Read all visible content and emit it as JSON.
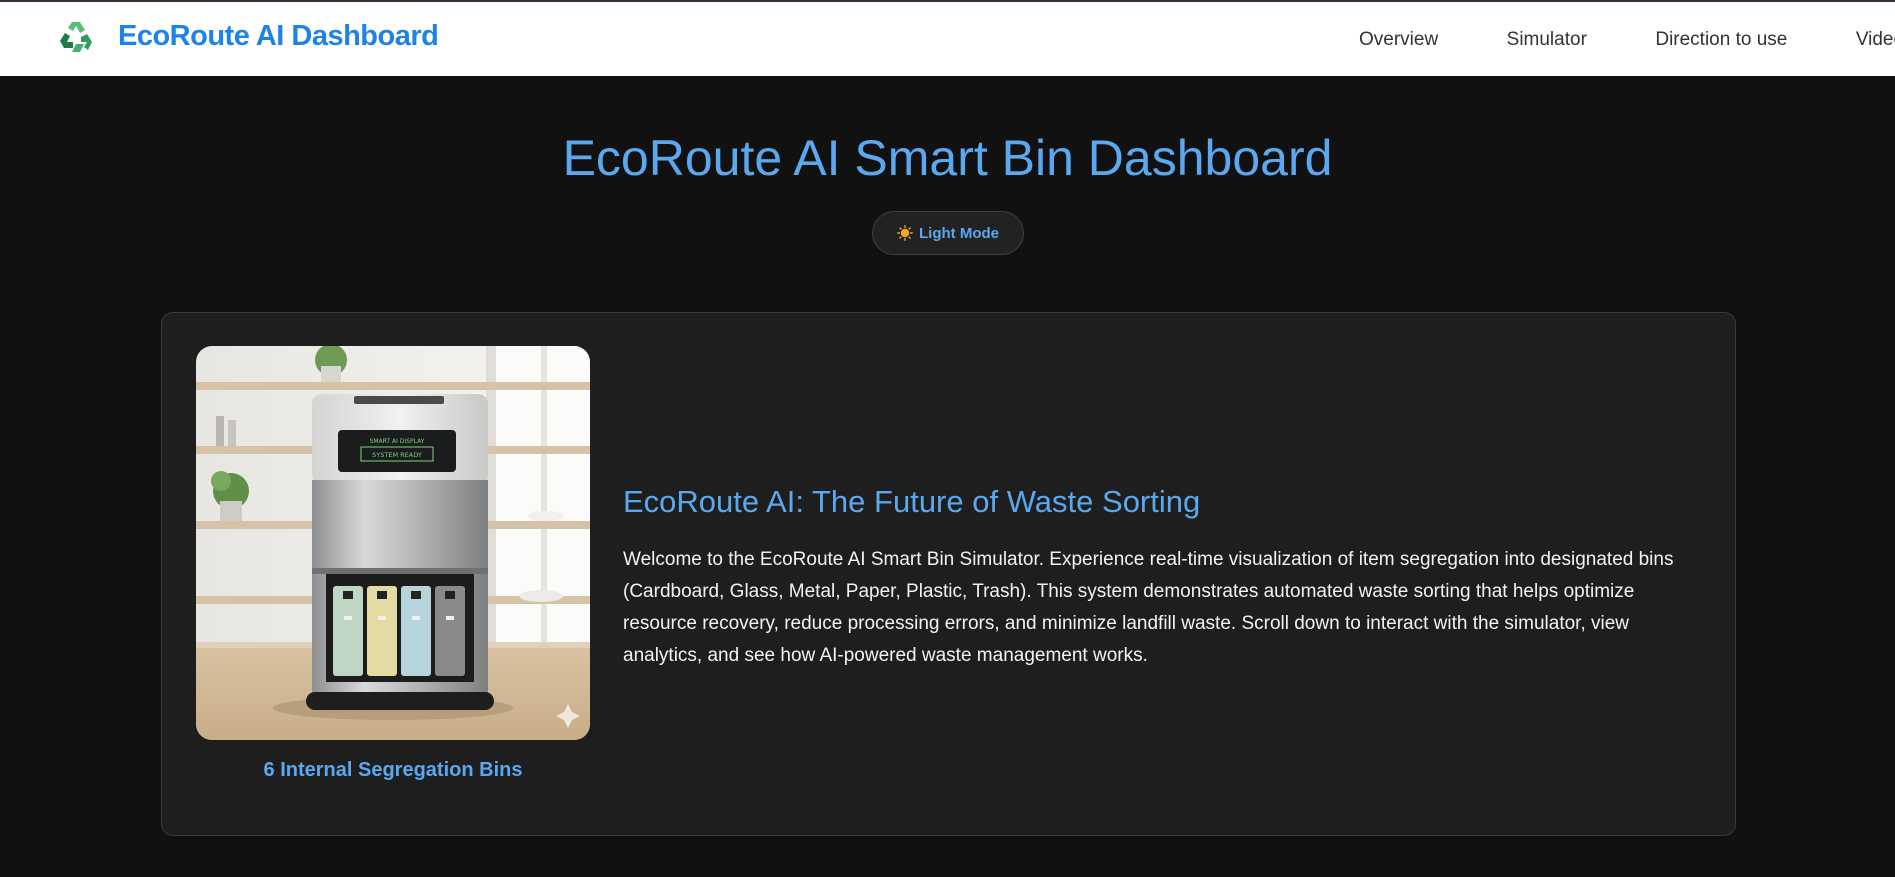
{
  "navbar": {
    "brand": "EcoRoute AI Dashboard",
    "logo_icon": "recycle-icon",
    "links": [
      {
        "label": "Overview"
      },
      {
        "label": "Simulator"
      },
      {
        "label": "Direction to use"
      },
      {
        "label": "Video D"
      }
    ]
  },
  "header": {
    "title": "EcoRoute AI Smart Bin Dashboard",
    "mode_button": {
      "icon": "sun-icon",
      "label": "Light Mode"
    }
  },
  "intro_card": {
    "image_caption": "6 Internal Segregation Bins",
    "image_display_small": "SMART AI DISPLAY",
    "image_display_status": "SYSTEM READY",
    "heading": "EcoRoute AI: The Future of Waste Sorting",
    "body": "Welcome to the EcoRoute AI Smart Bin Simulator. Experience real-time visualization of item segregation into designated bins (Cardboard, Glass, Metal, Paper, Plastic, Trash). This system demonstrates automated waste sorting that helps optimize resource recovery, reduce processing errors, and minimize landfill waste. Scroll down to interact with the simulator, view analytics, and see how AI-powered waste management works."
  },
  "colors": {
    "accent": "#5aa8ef",
    "brand": "#1f82e8",
    "page_background": "#111111",
    "card_background": "#1e1e1e"
  }
}
